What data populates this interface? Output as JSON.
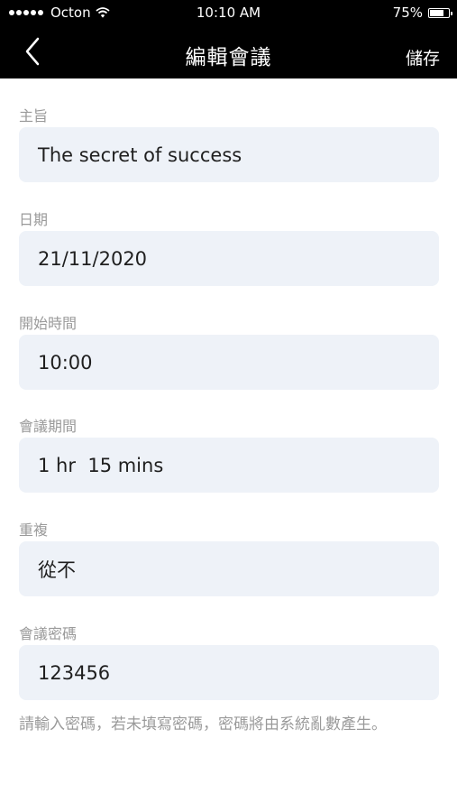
{
  "status_bar": {
    "carrier": "Octon",
    "time": "10:10 AM",
    "battery": "75%",
    "battery_level": 0.75,
    "signal_bars": 5
  },
  "nav": {
    "title": "編輯會議",
    "save_label": "儲存",
    "back_icon": "chevron-left-icon"
  },
  "fields": [
    {
      "label": "主旨",
      "value": "The secret of success"
    },
    {
      "label": "日期",
      "value": "21/11/2020"
    },
    {
      "label": "開始時間",
      "value": "10:00"
    },
    {
      "label": "會議期間",
      "value": "1 hr  15 mins"
    },
    {
      "label": "重複",
      "value": "從不"
    },
    {
      "label": "會議密碼",
      "value": "123456"
    }
  ],
  "hint": "請輸入密碼，若未填寫密碼，密碼將由系統亂數產生。",
  "colors": {
    "bar_background": "#000000",
    "field_background": "#eef2f8",
    "label_text": "#9a9a9a",
    "value_text": "#1f1f1f"
  }
}
